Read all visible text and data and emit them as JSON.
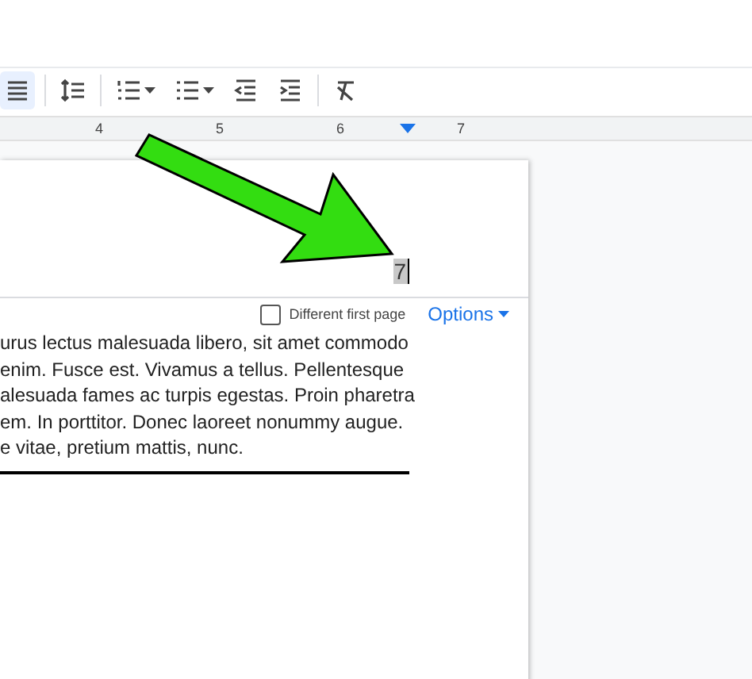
{
  "toolbar": {
    "tools": [
      {
        "kind": "align",
        "selected": true
      },
      {
        "kind": "line-spacing",
        "selected": false
      },
      {
        "kind": "numbered-list",
        "selected": false,
        "menu": true
      },
      {
        "kind": "bulleted-list",
        "selected": false,
        "menu": true
      },
      {
        "kind": "indent-decrease",
        "selected": false
      },
      {
        "kind": "indent-increase",
        "selected": false
      },
      {
        "kind": "clear-formatting",
        "selected": false
      }
    ]
  },
  "ruler": {
    "numbers": [
      "4",
      "5",
      "6",
      "7"
    ]
  },
  "header": {
    "text": "7",
    "different_first_page": {
      "label": "Different first page",
      "checked": false
    },
    "options": "Options"
  },
  "body": {
    "lines": [
      "urus lectus malesuada libero, sit amet commodo",
      "enim. Fusce est. Vivamus a tellus. Pellentesque",
      "alesuada fames ac turpis egestas. Proin pharetra",
      "em. In porttitor. Donec laoreet nonummy augue.",
      "e vitae, pretium mattis, nunc."
    ]
  }
}
